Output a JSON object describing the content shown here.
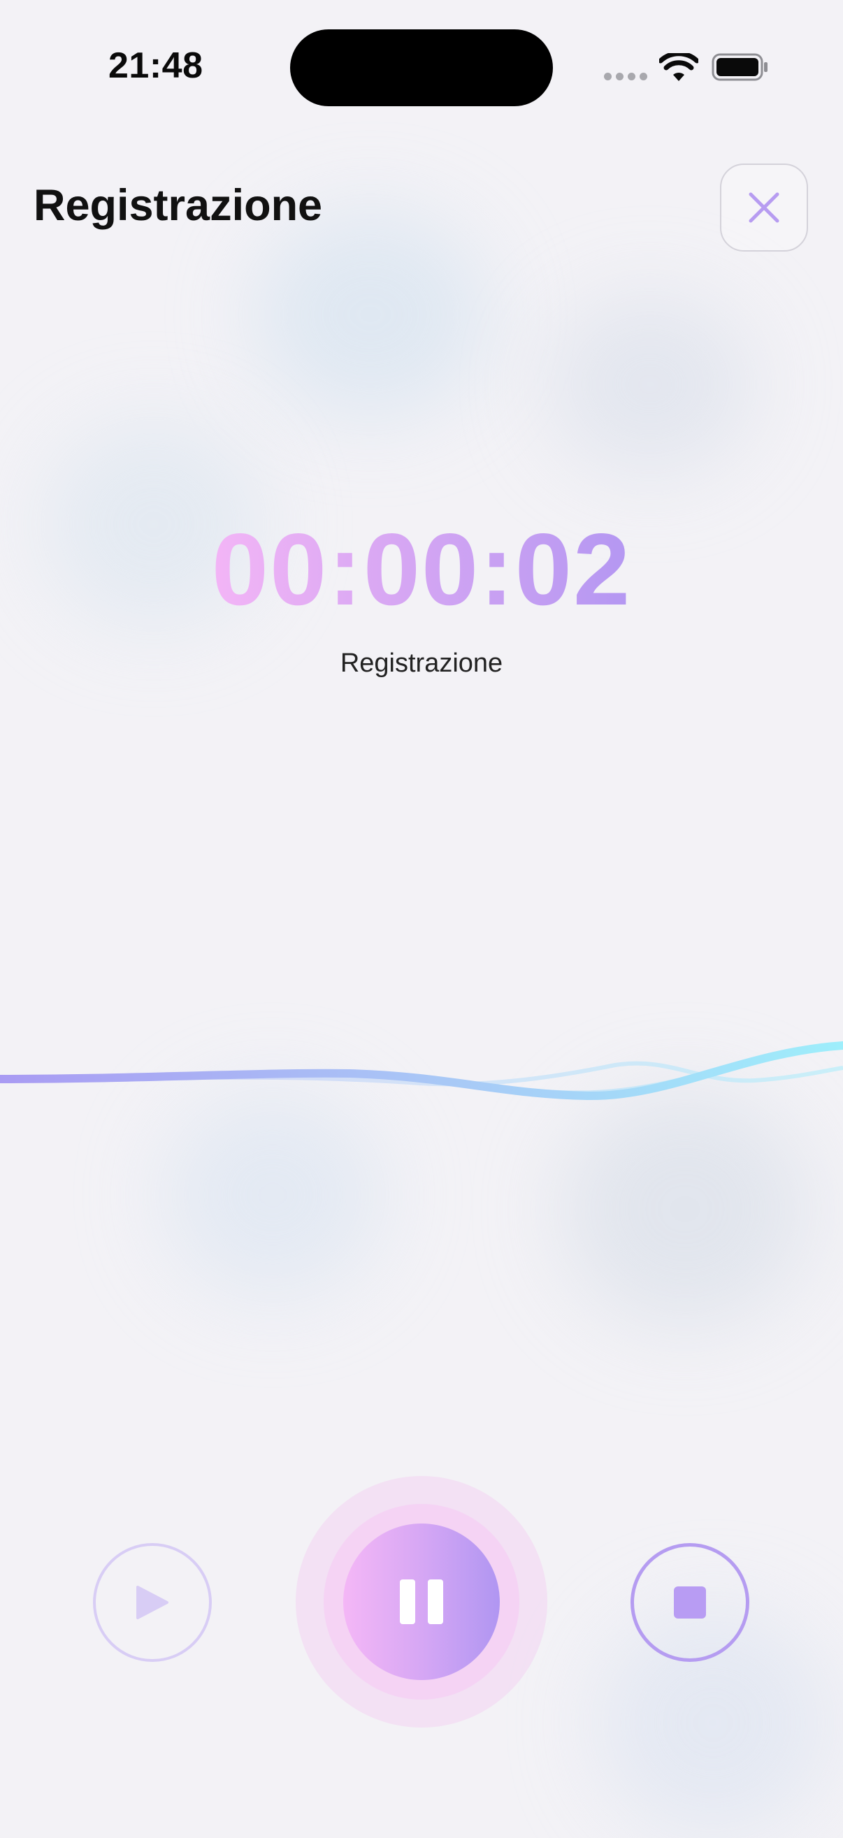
{
  "status_bar": {
    "time": "21:48"
  },
  "header": {
    "title": "Registrazione"
  },
  "recorder": {
    "elapsed": "00:00:02",
    "state_label": "Registrazione"
  },
  "controls": {
    "play": "play-icon",
    "pause": "pause-icon",
    "stop": "stop-icon",
    "close": "close-icon"
  },
  "colors": {
    "accent_pink": "#f3b5f6",
    "accent_purple": "#b497f2",
    "wave_cyan": "#9eeefb",
    "background": "#f3f2f6"
  }
}
